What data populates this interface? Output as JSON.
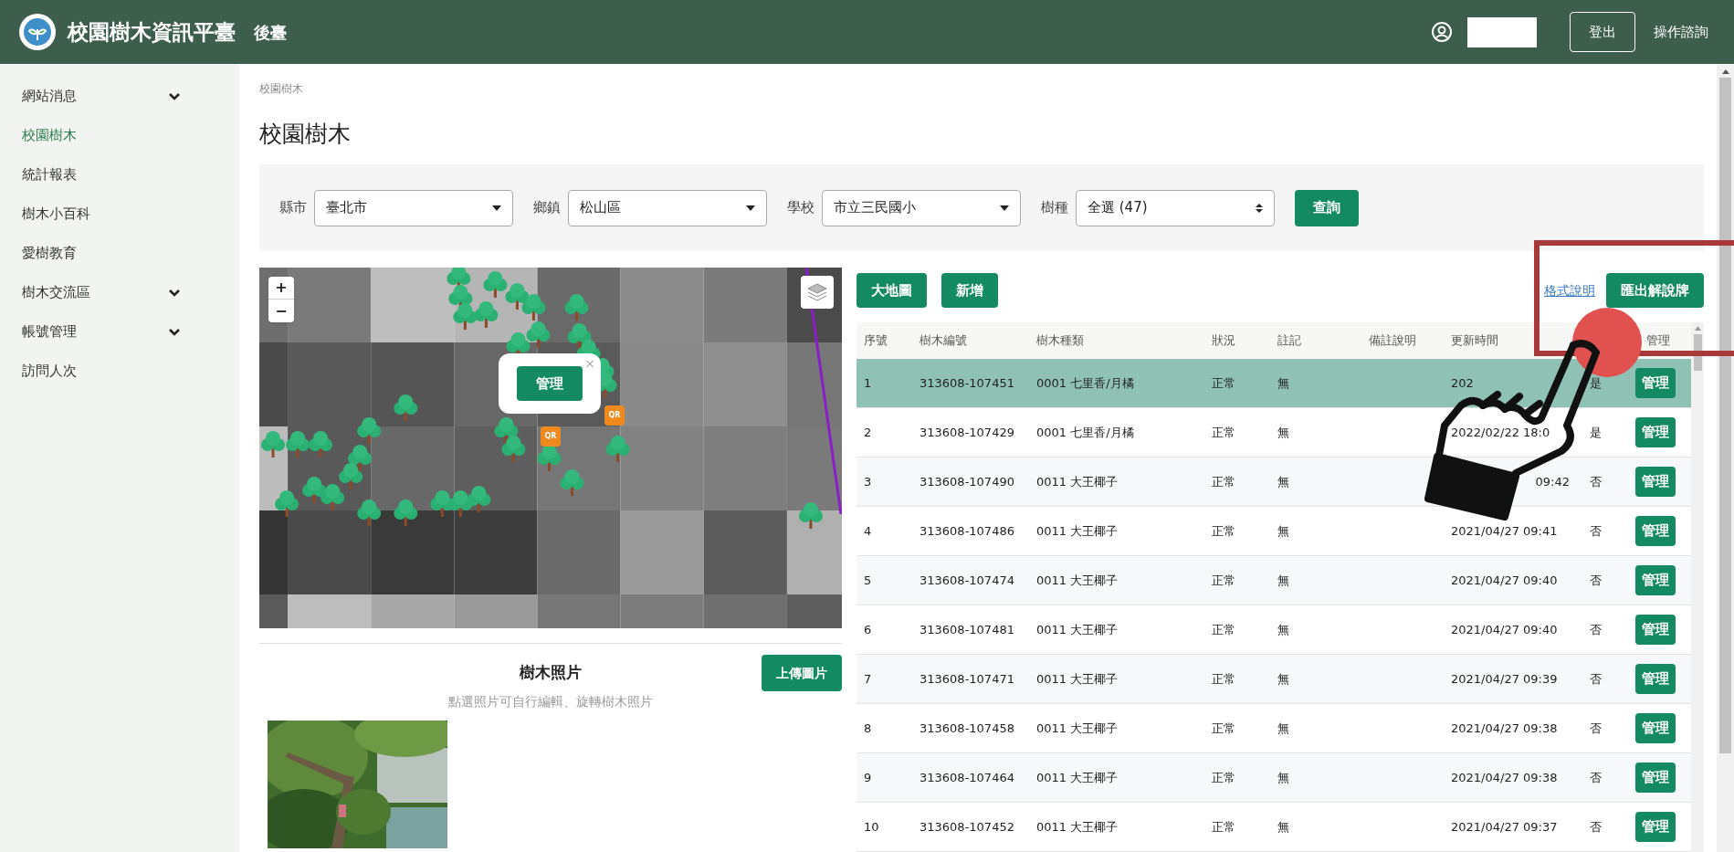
{
  "header": {
    "title": "校園樹木資訊平臺",
    "subtitle": "後臺",
    "logout": "登出",
    "help": "操作諮詢"
  },
  "sidebar": {
    "items": [
      {
        "label": "網站消息",
        "selected": false,
        "has_submenu": true
      },
      {
        "label": "校園樹木",
        "selected": true,
        "has_submenu": false
      },
      {
        "label": "統計報表",
        "selected": false,
        "has_submenu": false
      },
      {
        "label": "樹木小百科",
        "selected": false,
        "has_submenu": false
      },
      {
        "label": "愛樹教育",
        "selected": false,
        "has_submenu": false
      },
      {
        "label": "樹木交流區",
        "selected": false,
        "has_submenu": true
      },
      {
        "label": "帳號管理",
        "selected": false,
        "has_submenu": true
      },
      {
        "label": "訪問人次",
        "selected": false,
        "has_submenu": false
      }
    ]
  },
  "breadcrumb": "校園樹木",
  "page_title": "校園樹木",
  "filters": [
    {
      "label": "縣市",
      "value": "臺北市",
      "kind": "dropdown"
    },
    {
      "label": "鄉鎮",
      "value": "松山區",
      "kind": "dropdown"
    },
    {
      "label": "學校",
      "value": "市立三民國小",
      "kind": "dropdown"
    },
    {
      "label": "樹種",
      "value": "全選 (47)",
      "kind": "spinner"
    }
  ],
  "search_button": "查詢",
  "map": {
    "zoom_in": "+",
    "zoom_out": "−",
    "popup_button": "管理",
    "popup_close": "×",
    "markers": [
      "QR",
      "QR"
    ]
  },
  "photos": {
    "title": "樹木照片",
    "upload_button": "上傳圖片",
    "hint": "點選照片可自行編輯、旋轉樹木照片"
  },
  "table": {
    "buttons": [
      "大地圖",
      "新增"
    ],
    "format_link": "格式說明",
    "export_button": "匯出解說牌",
    "columns": [
      "序號",
      "樹木編號",
      "樹木種類",
      "狀況",
      "註記",
      "備註說明",
      "更新時間",
      "管理"
    ],
    "rows": [
      {
        "no": "1",
        "tree_id": "313608-107451",
        "species": "0001 七里香/月橘",
        "status": "正常",
        "note": "無",
        "updated": "202",
        "updated_end_only": false,
        "flag": "是",
        "action": "管理",
        "selected": true
      },
      {
        "no": "2",
        "tree_id": "313608-107429",
        "species": "0001 七里香/月橘",
        "status": "正常",
        "note": "無",
        "updated": "2022/02/22 18:0",
        "updated_end_only": false,
        "flag": "是",
        "action": "管理",
        "selected": false
      },
      {
        "no": "3",
        "tree_id": "313608-107490",
        "species": "0011 大王椰子",
        "status": "正常",
        "note": "無",
        "updated": "09:42",
        "updated_end_only": true,
        "flag": "否",
        "action": "管理",
        "selected": false
      },
      {
        "no": "4",
        "tree_id": "313608-107486",
        "species": "0011 大王椰子",
        "status": "正常",
        "note": "無",
        "updated": "2021/04/27 09:41",
        "updated_end_only": false,
        "flag": "否",
        "action": "管理",
        "selected": false
      },
      {
        "no": "5",
        "tree_id": "313608-107474",
        "species": "0011 大王椰子",
        "status": "正常",
        "note": "無",
        "updated": "2021/04/27 09:40",
        "updated_end_only": false,
        "flag": "否",
        "action": "管理",
        "selected": false
      },
      {
        "no": "6",
        "tree_id": "313608-107481",
        "species": "0011 大王椰子",
        "status": "正常",
        "note": "無",
        "updated": "2021/04/27 09:40",
        "updated_end_only": false,
        "flag": "否",
        "action": "管理",
        "selected": false
      },
      {
        "no": "7",
        "tree_id": "313608-107471",
        "species": "0011 大王椰子",
        "status": "正常",
        "note": "無",
        "updated": "2021/04/27 09:39",
        "updated_end_only": false,
        "flag": "否",
        "action": "管理",
        "selected": false
      },
      {
        "no": "8",
        "tree_id": "313608-107458",
        "species": "0011 大王椰子",
        "status": "正常",
        "note": "無",
        "updated": "2021/04/27 09:38",
        "updated_end_only": false,
        "flag": "否",
        "action": "管理",
        "selected": false
      },
      {
        "no": "9",
        "tree_id": "313608-107464",
        "species": "0011 大王椰子",
        "status": "正常",
        "note": "無",
        "updated": "2021/04/27 09:38",
        "updated_end_only": false,
        "flag": "否",
        "action": "管理",
        "selected": false
      },
      {
        "no": "10",
        "tree_id": "313608-107452",
        "species": "0011 大王椰子",
        "status": "正常",
        "note": "無",
        "updated": "2021/04/27 09:37",
        "updated_end_only": false,
        "flag": "否",
        "action": "管理",
        "selected": false
      }
    ]
  }
}
